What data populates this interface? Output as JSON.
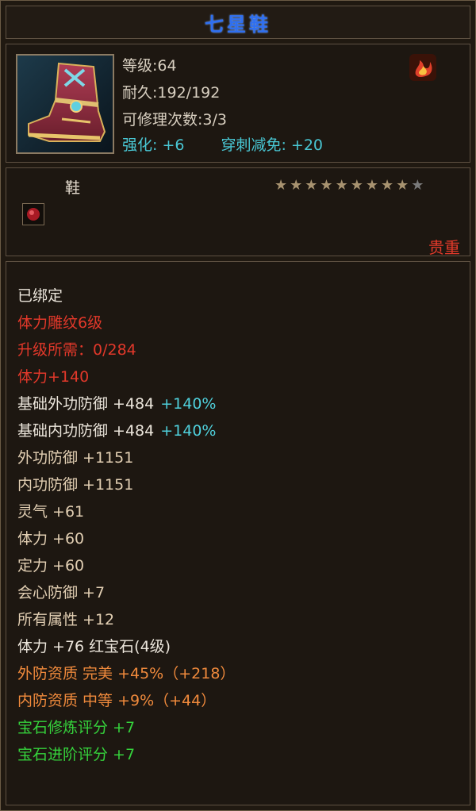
{
  "title": "七星鞋",
  "item": {
    "icon": "boots-icon",
    "level": "等级:64",
    "durability": "耐久:192/192",
    "repair_count": "可修理次数:3/3",
    "enhance": "强化: +6",
    "pierce_reduction": "穿刺减免: +20",
    "element_icon": "fire-icon"
  },
  "type": "鞋",
  "stars": {
    "lit": 9,
    "total": 10
  },
  "rarity": "贵重",
  "attributes": [
    {
      "text": "已绑定",
      "color": "white"
    },
    {
      "text": "体力雕纹6级",
      "color": "red"
    },
    {
      "text": "升级所需：0/284",
      "color": "red"
    },
    {
      "text": "体力+140",
      "color": "red"
    },
    {
      "text": "基础外功防御 +484",
      "extra": "+140%",
      "color": "white"
    },
    {
      "text": "基础内功防御 +484",
      "extra": "+140%",
      "color": "white"
    },
    {
      "text": "外功防御 +1151",
      "color": "tan"
    },
    {
      "text": "内功防御 +1151",
      "color": "tan"
    },
    {
      "text": "灵气 +61",
      "color": "tan"
    },
    {
      "text": "体力 +60",
      "color": "tan"
    },
    {
      "text": "定力 +60",
      "color": "tan"
    },
    {
      "text": "会心防御 +7",
      "color": "tan"
    },
    {
      "text": "所有属性 +12",
      "color": "tan"
    },
    {
      "text": "体力 +76 红宝石(4级)",
      "color": "white"
    },
    {
      "text": "外防资质  完美 +45%（+218）",
      "color": "orange"
    },
    {
      "text": "内防资质  中等 +9%（+44）",
      "color": "orange"
    },
    {
      "text": "宝石修炼评分 +7",
      "color": "green"
    },
    {
      "text": "宝石进阶评分 +7",
      "color": "green"
    }
  ],
  "colors": {
    "title": "#2f6ff0",
    "rarity": "#e23a2a",
    "red": "#e2382a",
    "tan": "#e2cfb3",
    "orange": "#f08a3c",
    "green": "#35d23c",
    "cyan": "#4fd0dc"
  }
}
